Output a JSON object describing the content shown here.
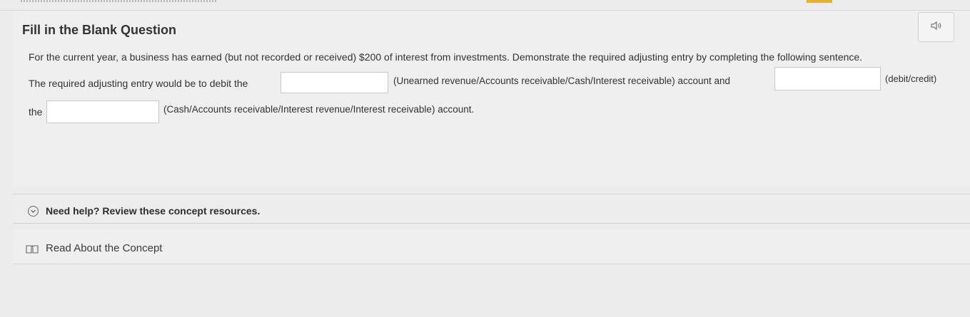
{
  "question": {
    "type_title": "Fill in the Blank Question",
    "audio_icon": "speaker-icon",
    "prompt": "For the current year, a business has earned (but not recorded or received) $200 of interest from investments. Demonstrate the required adjusting entry by completing the following sentence.",
    "line1_start": "The required adjusting entry would be to debit the",
    "blank1_options": "(Unearned revenue/Accounts receivable/Cash/Interest receivable) account and",
    "blank2_options": "(debit/credit)",
    "line2_start": "the",
    "blank3_options": "(Cash/Accounts receivable/Interest revenue/Interest receivable) account.",
    "blanks": [
      "",
      "",
      ""
    ]
  },
  "help": {
    "toggle_icon": "chevron-down-icon",
    "label": "Need help? Review these concept resources.",
    "resource_icon": "book-icon",
    "resource_label": "Read About the Concept"
  }
}
